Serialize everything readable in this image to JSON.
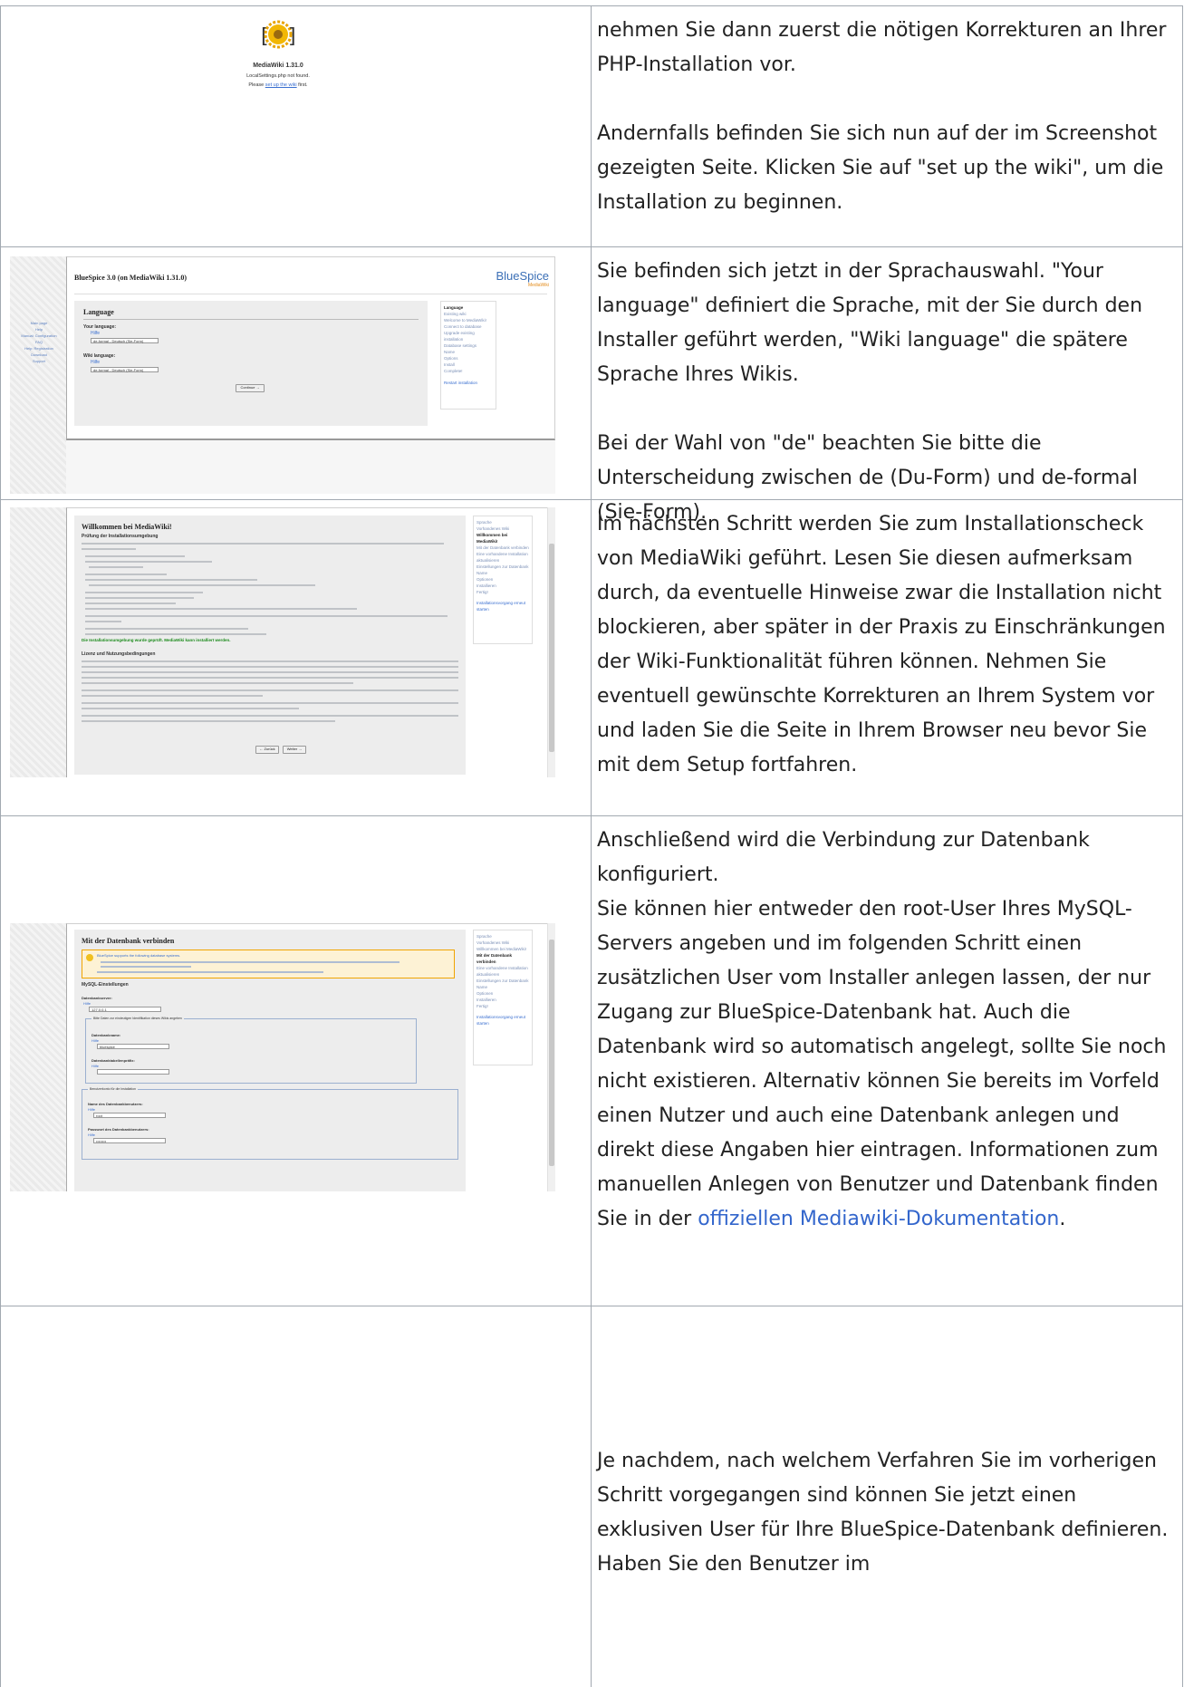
{
  "rows": [
    {
      "screenshot": {
        "title": "MediaWiki 1.31.0",
        "line1": "LocalSettings.php not found.",
        "line2_pre": "Please ",
        "line2_link": "set up the wiki",
        "line2_post": " first."
      },
      "paragraphs": [
        "nehmen Sie dann zuerst die nötigen Korrekturen an Ihrer PHP-Installation vor.",
        "Andernfalls befinden Sie sich nun auf der im Screenshot gezeigten Seite. Klicken Sie auf \"set up the wiki\", um die Installation zu beginnen."
      ]
    },
    {
      "screenshot": {
        "header": "BlueSpice 3.0 (on MediaWiki 1.31.0)",
        "logo": "BlueSpice",
        "logo_sub": "MediaWiki",
        "heading": "Language",
        "your_language_label": "Your language:",
        "wiki_language_label": "Wiki language:",
        "help": "Hilfe",
        "select_value": "de-formal - Deutsch (Sie-Form)",
        "continue_button": "Continue →",
        "sidebar_links": [
          "Main page",
          "Help",
          "Manual: Configuration",
          "FAQ",
          "Help: Registration",
          "Download",
          "Support"
        ],
        "toc": [
          "Language",
          "Existing wiki",
          "Welcome to MediaWiki!",
          "Connect to database",
          "Upgrade existing installation",
          "Database settings",
          "Name",
          "Options",
          "Install",
          "Complete!",
          "Restart installation"
        ]
      },
      "paragraphs": [
        "Sie befinden sich jetzt in der Sprachauswahl. \"Your language\" definiert die Sprache, mit der Sie durch den Installer geführt werden, \"Wiki language\" die spätere Sprache Ihres Wikis.",
        "Bei der Wahl von \"de\" beachten Sie bitte die Unterscheidung zwischen de (Du-Form) und de-formal (Sie-Form)."
      ]
    },
    {
      "screenshot": {
        "heading": "Willkommen bei MediaWiki!",
        "subheading": "Prüfung der Installationsumgebung",
        "ok_line": "Die Installationsumgebung wurde geprüft. MediaWiki kann installiert werden.",
        "license_heading": "Lizenz und Nutzungsbedingungen",
        "back_button": "← Zurück",
        "next_button": "Weiter →",
        "toc": [
          "Sprache",
          "Vorhandenes Wiki",
          "Willkommen bei MediaWiki!",
          "Mit der Datenbank verbinden",
          "Eine vorhandene Installation aktualisieren",
          "Einstellungen zur Datenbank",
          "Name",
          "Optionen",
          "Installieren",
          "Fertig!",
          "Installationsvorgang erneut starten"
        ]
      },
      "paragraphs": [
        "Im nächsten Schritt werden Sie zum Installationscheck von MediaWiki geführt. Lesen Sie diesen aufmerksam durch, da eventuelle Hinweise zwar die Installation nicht blockieren, aber später in der Praxis zu Einschränkungen der Wiki-Funktionalität führen können. Nehmen Sie eventuell gewünschte Korrekturen an Ihrem System vor und laden Sie die Seite in Ihrem Browser neu bevor Sie mit dem Setup fortfahren."
      ]
    },
    {
      "screenshot": {
        "heading": "Mit der Datenbank verbinden",
        "notice": "BlueSpice supports the following database systems.",
        "section": "MySQL-Einstellungen",
        "server_label": "Datenbankserver:",
        "server_value": "127.0.0.1",
        "fieldset1": "Bitte Daten zur eindeutigen Identifikation dieses Wikis angeben",
        "dbname_label": "Datenbankname:",
        "dbname_value": "bluespice",
        "prefix_label": "Datenbanktabellenpräfix:",
        "fieldset2": "Benutzerkonto für die Installation",
        "user_label": "Name des Datenbankbenutzers:",
        "user_value": "root",
        "pass_label": "Passwort des Datenbankbenutzers:",
        "pass_value": "••••••••",
        "help": "Hilfe",
        "toc": [
          "Sprache",
          "Vorhandenes Wiki",
          "Willkommen bei MediaWiki!",
          "Mit der Datenbank verbinden",
          "Eine vorhandene Installation aktualisieren",
          "Einstellungen zur Datenbank",
          "Name",
          "Optionen",
          "Installieren",
          "Fertig!",
          "Installationsvorgang erneut starten"
        ]
      },
      "paragraphs_lead": [
        "Anschließend wird die Verbindung zur Datenbank konfiguriert.",
        "Sie können hier entweder den root-User Ihres MySQL-Servers angeben und im folgenden Schritt einen zusätzlichen User vom Installer anlegen lassen, der nur Zugang zur BlueSpice-Datenbank hat. Auch die Datenbank wird so automatisch angelegt, sollte Sie noch nicht existieren. Alternativ können Sie bereits im Vorfeld einen Nutzer und auch eine Datenbank anlegen und direkt diese Angaben hier eintragen. Informationen zum manuellen Anlegen von Benutzer und Datenbank finden Sie in der "
      ],
      "link_text": "offiziellen Mediawiki-Dokumentation",
      "link_after": "."
    },
    {
      "paragraphs": [
        "Je nachdem, nach welchem Verfahren Sie im vorherigen Schritt vorgegangen sind können Sie jetzt einen exklusiven User für Ihre BlueSpice-Datenbank definieren. Haben Sie den Benutzer im"
      ]
    }
  ]
}
